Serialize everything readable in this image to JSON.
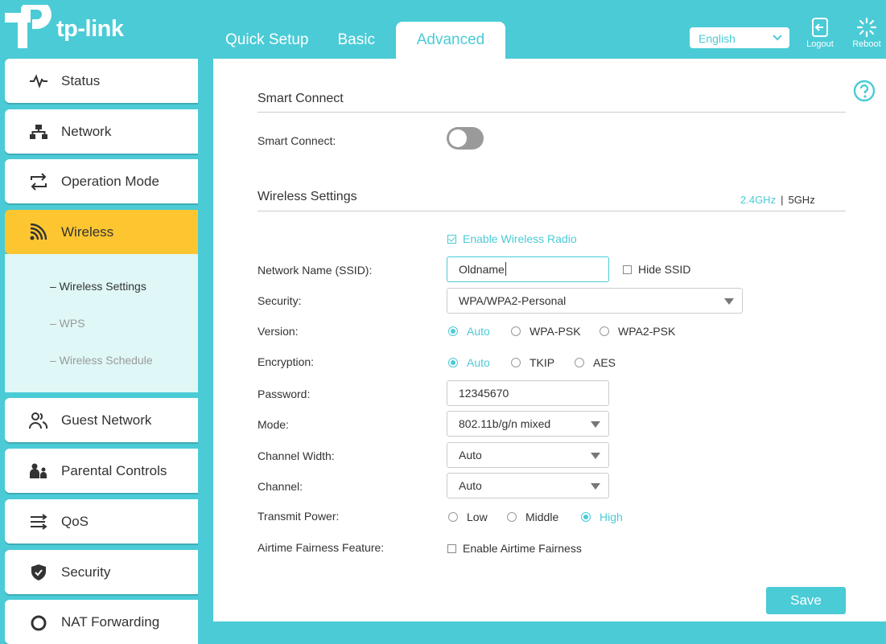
{
  "brand": {
    "logo_text": "tp-link",
    "accent_color": "#4acbd6",
    "highlight_color": "#fdc630"
  },
  "tabs": [
    {
      "label": "Quick Setup"
    },
    {
      "label": "Basic"
    },
    {
      "label": "Advanced",
      "active": true
    }
  ],
  "language": {
    "selected": "English",
    "icon": "chevron-down-icon"
  },
  "header_actions": {
    "logout": {
      "label": "Logout",
      "icon": "logout-icon"
    },
    "reboot": {
      "label": "Reboot",
      "icon": "reboot-icon"
    }
  },
  "sidebar": {
    "items": [
      {
        "label": "Status",
        "icon": "pulse-icon"
      },
      {
        "label": "Network",
        "icon": "network-icon"
      },
      {
        "label": "Operation Mode",
        "icon": "swap-icon"
      },
      {
        "label": "Wireless",
        "icon": "wifi-icon",
        "active": true
      },
      {
        "label": "Guest Network",
        "icon": "users-icon"
      },
      {
        "label": "Parental Controls",
        "icon": "family-icon"
      },
      {
        "label": "QoS",
        "icon": "qos-icon"
      },
      {
        "label": "Security",
        "icon": "shield-icon"
      },
      {
        "label": "NAT Forwarding",
        "icon": "nat-icon"
      }
    ],
    "wireless_submenu": [
      {
        "label": "–  Wireless Settings",
        "active": true
      },
      {
        "label": "–  WPS"
      },
      {
        "label": "–  Wireless Schedule"
      }
    ]
  },
  "help_icon": "help-icon",
  "smart_connect": {
    "title": "Smart Connect",
    "label": "Smart Connect:",
    "enabled": false
  },
  "wireless_settings": {
    "title": "Wireless Settings",
    "band_24": "2.4GHz",
    "band_sep": "|",
    "band_5": "5GHz",
    "enable_radio": {
      "label": "Enable Wireless Radio",
      "checked": true
    },
    "ssid": {
      "label": "Network Name (SSID):",
      "value": "Oldname"
    },
    "hide_ssid": {
      "label": "Hide SSID",
      "checked": false
    },
    "security": {
      "label": "Security:",
      "value": "WPA/WPA2-Personal"
    },
    "version": {
      "label": "Version:",
      "options": [
        "Auto",
        "WPA-PSK",
        "WPA2-PSK"
      ],
      "selected": "Auto"
    },
    "encryption": {
      "label": "Encryption:",
      "options": [
        "Auto",
        "TKIP",
        "AES"
      ],
      "selected": "Auto"
    },
    "password": {
      "label": "Password:",
      "value": "12345670"
    },
    "mode": {
      "label": "Mode:",
      "value": "802.11b/g/n mixed"
    },
    "channel_width": {
      "label": "Channel Width:",
      "value": "Auto"
    },
    "channel": {
      "label": "Channel:",
      "value": "Auto"
    },
    "transmit_power": {
      "label": "Transmit Power:",
      "options": [
        "Low",
        "Middle",
        "High"
      ],
      "selected": "High"
    },
    "airtime": {
      "label": "Airtime Fairness Feature:",
      "checkbox_label": "Enable Airtime Fairness",
      "checked": false
    }
  },
  "save_label": "Save"
}
